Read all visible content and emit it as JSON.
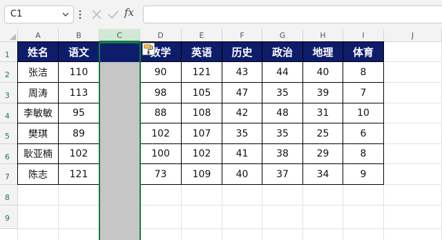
{
  "formula_bar": {
    "name_box": "C1",
    "fx_label": "fx",
    "formula": ""
  },
  "columns": [
    "A",
    "B",
    "C",
    "D",
    "E",
    "F",
    "G",
    "H",
    "I",
    "J"
  ],
  "rows": [
    "1",
    "2",
    "3",
    "4",
    "5",
    "6",
    "7",
    "8",
    "9"
  ],
  "selected_column": "C",
  "table": {
    "left_headers": [
      "姓名",
      "语文"
    ],
    "right_headers": [
      "数学",
      "英语",
      "历史",
      "政治",
      "地理",
      "体育"
    ],
    "records": [
      {
        "name": "张洁",
        "chinese": "110",
        "scores": [
          "90",
          "121",
          "43",
          "44",
          "40",
          "8"
        ]
      },
      {
        "name": "周涛",
        "chinese": "113",
        "scores": [
          "98",
          "105",
          "47",
          "35",
          "39",
          "7"
        ]
      },
      {
        "name": "李敏敏",
        "chinese": "95",
        "scores": [
          "88",
          "108",
          "42",
          "48",
          "31",
          "10"
        ]
      },
      {
        "name": "樊琪",
        "chinese": "89",
        "scores": [
          "102",
          "107",
          "35",
          "35",
          "25",
          "6"
        ]
      },
      {
        "name": "耿亚楠",
        "chinese": "102",
        "scores": [
          "100",
          "102",
          "41",
          "38",
          "29",
          "8"
        ]
      },
      {
        "name": "陈志",
        "chinese": "121",
        "scores": [
          "73",
          "109",
          "40",
          "37",
          "34",
          "9"
        ]
      }
    ]
  },
  "colors": {
    "header_fill": "#0e1d6b",
    "selection_green": "#107c41",
    "empty_column_fill": "#c6c6c6"
  },
  "icons": [
    "chevron-down-icon",
    "more-dots-icon",
    "cancel-icon",
    "enter-icon",
    "format-painter-icon"
  ]
}
